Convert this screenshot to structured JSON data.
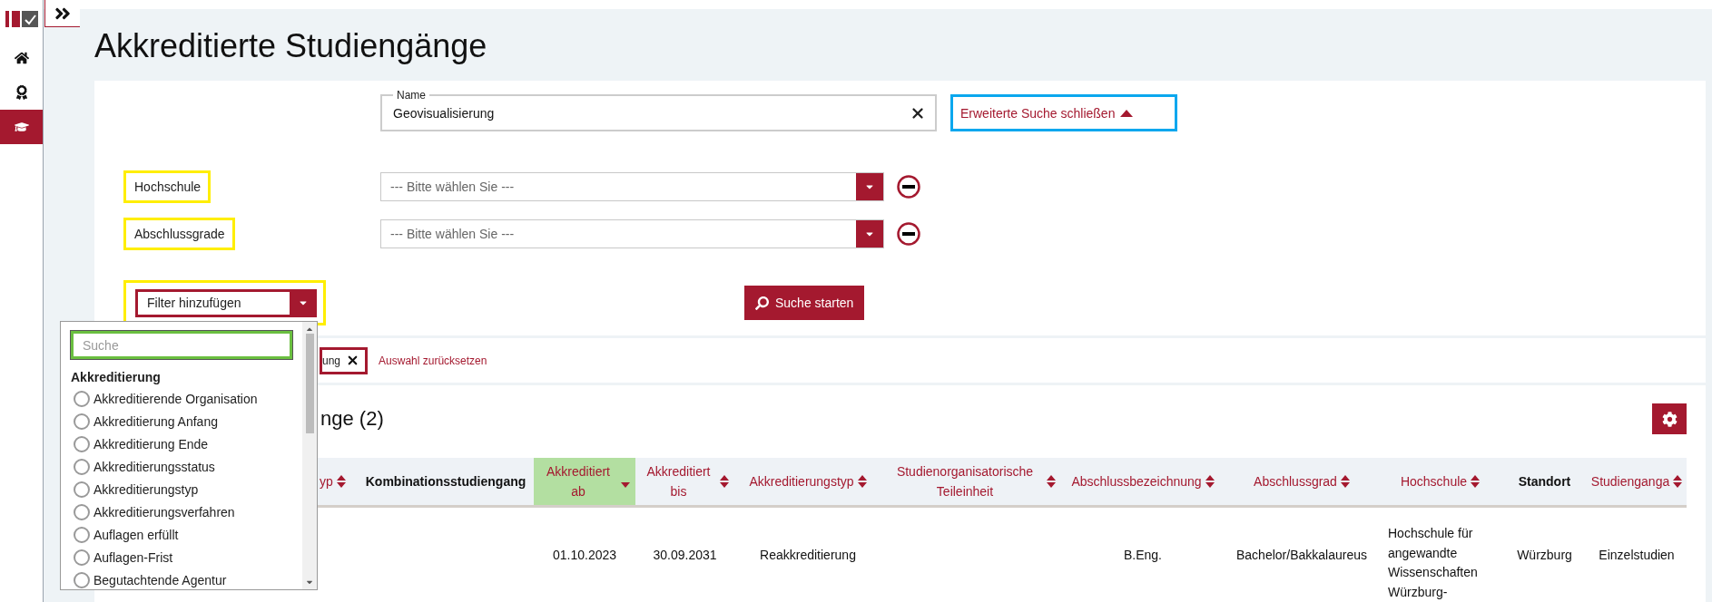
{
  "sidebar": {
    "items": [
      {
        "selected": false
      },
      {
        "selected": false
      },
      {
        "selected": true
      }
    ]
  },
  "page_title": "Akkreditierte Studiengänge",
  "search": {
    "name_field": {
      "label": "Name",
      "value": "Geovisualisierung"
    },
    "toggle_link": "Erweiterte Suche schließen",
    "filters": [
      {
        "label": "Hochschule",
        "placeholder": "--- Bitte wählen Sie ---"
      },
      {
        "label": "Abschlussgrade",
        "placeholder": "--- Bitte wählen Sie ---"
      }
    ],
    "add_filter": "Filter hinzufügen",
    "submit": "Suche starten"
  },
  "chips": {
    "items": [
      "ung"
    ],
    "reset": "Auswahl zurücksetzen"
  },
  "results": {
    "heading": "nge (2)",
    "table": {
      "columns": [
        {
          "label": "yp",
          "sortable": true,
          "selected": false
        },
        {
          "label": "Kombinationsstudiengang",
          "sortable": false,
          "selected": false
        },
        {
          "label": "Akkreditiert ab",
          "sortable": true,
          "selected": true
        },
        {
          "label": "Akkreditiert bis",
          "sortable": true,
          "selected": false
        },
        {
          "label": "Akkreditierungstyp",
          "sortable": true,
          "selected": false
        },
        {
          "label": "Studienorganisatorische Teileinheit",
          "sortable": true,
          "selected": false
        },
        {
          "label": "Abschlussbezeichnung",
          "sortable": true,
          "selected": false
        },
        {
          "label": "Abschlussgrad",
          "sortable": true,
          "selected": false
        },
        {
          "label": "Hochschule",
          "sortable": true,
          "selected": false
        },
        {
          "label": "Standort",
          "sortable": false,
          "selected": false
        },
        {
          "label": "Studienganga",
          "sortable": true,
          "selected": false
        }
      ],
      "rows": [
        {
          "cells": [
            null,
            null,
            "01.10.2023",
            "30.09.2031",
            "Reakkreditierung",
            null,
            "B.Eng.",
            "Bachelor/Bakkalaureus",
            "Hochschule für angewandte Wissenschaften Würzburg-",
            "Würzburg",
            "Einzelstudien"
          ]
        }
      ]
    }
  },
  "filter_dropdown": {
    "search_placeholder": "Suche",
    "groups": [
      {
        "label": "Akkreditierung",
        "options": [
          {
            "label": "Akkreditierende Organisation",
            "selected": false
          },
          {
            "label": "Akkreditierung Anfang",
            "selected": false
          },
          {
            "label": "Akkreditierung Ende",
            "selected": false
          },
          {
            "label": "Akkreditierungsstatus",
            "selected": false
          },
          {
            "label": "Akkreditierungstyp",
            "selected": false
          },
          {
            "label": "Akkreditierungsverfahren",
            "selected": false
          },
          {
            "label": "Auflagen erfüllt",
            "selected": false
          },
          {
            "label": "Auflagen-Frist",
            "selected": false
          },
          {
            "label": "Begutachtende Agentur",
            "selected": false
          }
        ]
      }
    ]
  }
}
